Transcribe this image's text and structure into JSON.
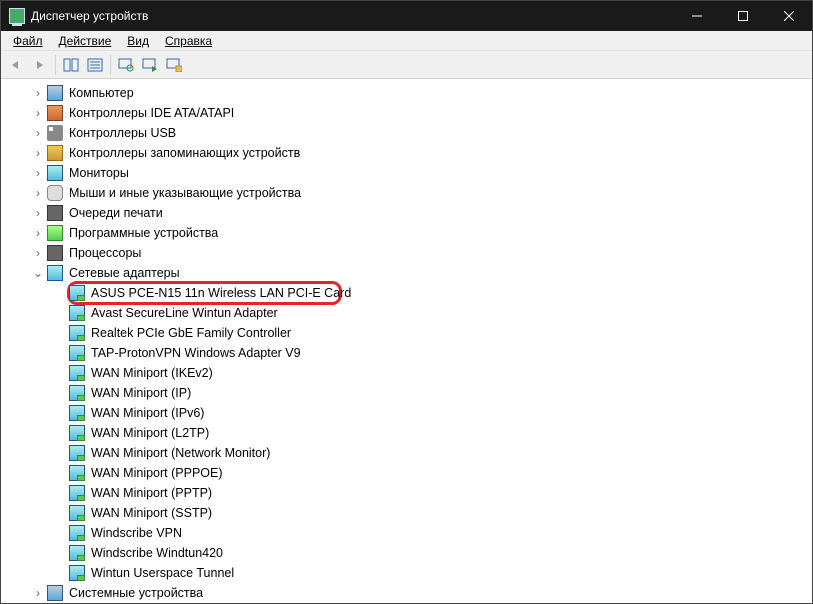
{
  "title": "Диспетчер устройств",
  "menu": {
    "file": "Файл",
    "action": "Действие",
    "view": "Вид",
    "help": "Справка"
  },
  "tree": {
    "categories": [
      {
        "icon": "ic-computer",
        "label": "Компьютер",
        "collapsed": true
      },
      {
        "icon": "ic-ide",
        "label": "Контроллеры IDE ATA/ATAPI",
        "collapsed": true
      },
      {
        "icon": "ic-usb",
        "label": "Контроллеры USB",
        "collapsed": true
      },
      {
        "icon": "ic-hid",
        "label": "Контроллеры запоминающих устройств",
        "collapsed": true
      },
      {
        "icon": "ic-monitor",
        "label": "Мониторы",
        "collapsed": true
      },
      {
        "icon": "ic-mouse",
        "label": "Мыши и иные указывающие устройства",
        "collapsed": true
      },
      {
        "icon": "ic-print",
        "label": "Очереди печати",
        "collapsed": true
      },
      {
        "icon": "ic-software",
        "label": "Программные устройства",
        "collapsed": true
      },
      {
        "icon": "ic-cpu",
        "label": "Процессоры",
        "collapsed": true
      }
    ],
    "networkCategory": {
      "icon": "ic-netcat",
      "label": "Сетевые адаптеры",
      "collapsed": false
    },
    "networkDevices": [
      "ASUS PCE-N15 11n Wireless LAN PCI-E Card",
      "Avast SecureLine Wintun Adapter",
      "Realtek PCIe GbE Family Controller",
      "TAP-ProtonVPN Windows Adapter V9",
      "WAN Miniport (IKEv2)",
      "WAN Miniport (IP)",
      "WAN Miniport (IPv6)",
      "WAN Miniport (L2TP)",
      "WAN Miniport (Network Monitor)",
      "WAN Miniport (PPPOE)",
      "WAN Miniport (PPTP)",
      "WAN Miniport (SSTP)",
      "Windscribe VPN",
      "Windscribe Windtun420",
      "Wintun Userspace Tunnel"
    ],
    "tailCategories": [
      {
        "icon": "ic-sys",
        "label": "Системные устройства",
        "collapsed": true
      }
    ]
  }
}
